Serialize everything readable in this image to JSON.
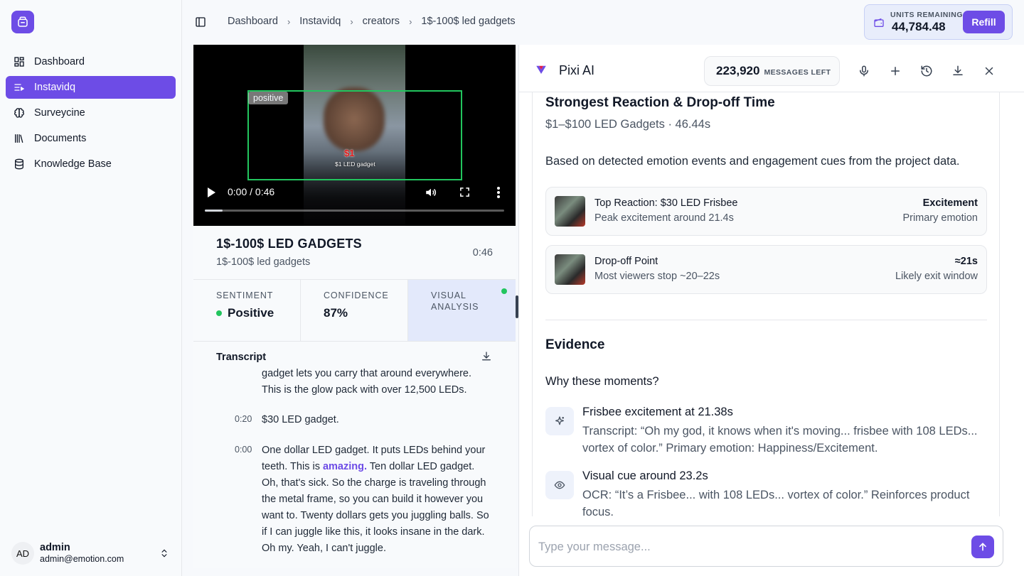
{
  "sidebar": {
    "items": [
      {
        "label": "Dashboard",
        "icon": "dashboard-icon"
      },
      {
        "label": "Instavidq",
        "icon": "list-video-icon",
        "active": true
      },
      {
        "label": "Surveycine",
        "icon": "brain-icon"
      },
      {
        "label": "Documents",
        "icon": "library-icon"
      },
      {
        "label": "Knowledge Base",
        "icon": "database-icon"
      }
    ],
    "user": {
      "initials": "AD",
      "name": "admin",
      "email": "admin@emotion.com"
    }
  },
  "breadcrumb": [
    "Dashboard",
    "Instavidq",
    "creators",
    "1$-100$ led gadgets"
  ],
  "units": {
    "label": "UNITS REMAINING",
    "value": "44,784.48",
    "refill_label": "Refill"
  },
  "video": {
    "overlay_tag": "positive",
    "overlay_price": "$1",
    "overlay_caption": "$1 LED gadget",
    "time": "0:00 / 0:46",
    "progress": 0.06,
    "title": "1$-100$ LED GADGETS",
    "subtitle": "1$-100$ led gadgets",
    "duration": "0:46"
  },
  "stats": {
    "sentiment_label": "SENTIMENT",
    "sentiment_value": "Positive",
    "confidence_label": "CONFIDENCE",
    "confidence_value": "87%",
    "visual_label_1": "VISUAL",
    "visual_label_2": "ANALYSIS"
  },
  "transcript": {
    "heading": "Transcript",
    "entries": [
      {
        "time": "",
        "text": "gadget lets you carry that around everywhere. This is the glow pack with over 12,500 LEDs."
      },
      {
        "time": "0:20",
        "text": "$30 LED gadget."
      },
      {
        "time": "0:00",
        "text_before": "One dollar LED gadget. It puts LEDs behind your teeth. This is ",
        "highlight": "amazing.",
        "text_after": " Ten dollar LED gadget. Oh, that's sick. So the charge is traveling through the metal frame, so you can build it however you want to. Twenty dollars gets you juggling balls. So if I can juggle like this, it looks insane in the dark. Oh my. Yeah, I can't juggle."
      }
    ]
  },
  "pixi": {
    "name": "Pixi AI",
    "messages_value": "223,920",
    "messages_label": "MESSAGES LEFT",
    "heading": "Strongest Reaction & Drop-off Time",
    "subheading": "$1–$100 LED Gadgets · 46.44s",
    "paragraph": "Based on detected emotion events and engagement cues from the project data.",
    "cards": [
      {
        "title": "Top Reaction: $30 LED Frisbee",
        "subtitle": "Peak excitement around 21.4s",
        "right_title": "Excitement",
        "right_sub": "Primary emotion"
      },
      {
        "title": "Drop-off Point",
        "subtitle": "Most viewers stop ~20–22s",
        "right_title": "≈21s",
        "right_sub": "Likely exit window"
      }
    ],
    "evidence_heading": "Evidence",
    "why_heading": "Why these moments?",
    "evidence": [
      {
        "title": "Frisbee excitement at 21.38s",
        "text": "Transcript: “Oh my god, it knows when it's moving... frisbee with 108 LEDs... vortex of color.” Primary emotion: Happiness/Excitement.",
        "icon": "sparkles-icon"
      },
      {
        "title": "Visual cue around 23.2s",
        "text": "OCR: “It’s a Frisbee... with 108 LEDs... vortex of color.” Reinforces product focus.",
        "icon": "eye-icon"
      }
    ],
    "input_placeholder": "Type your message..."
  },
  "colors": {
    "accent": "#6d4ce6",
    "positive": "#22c55e"
  }
}
